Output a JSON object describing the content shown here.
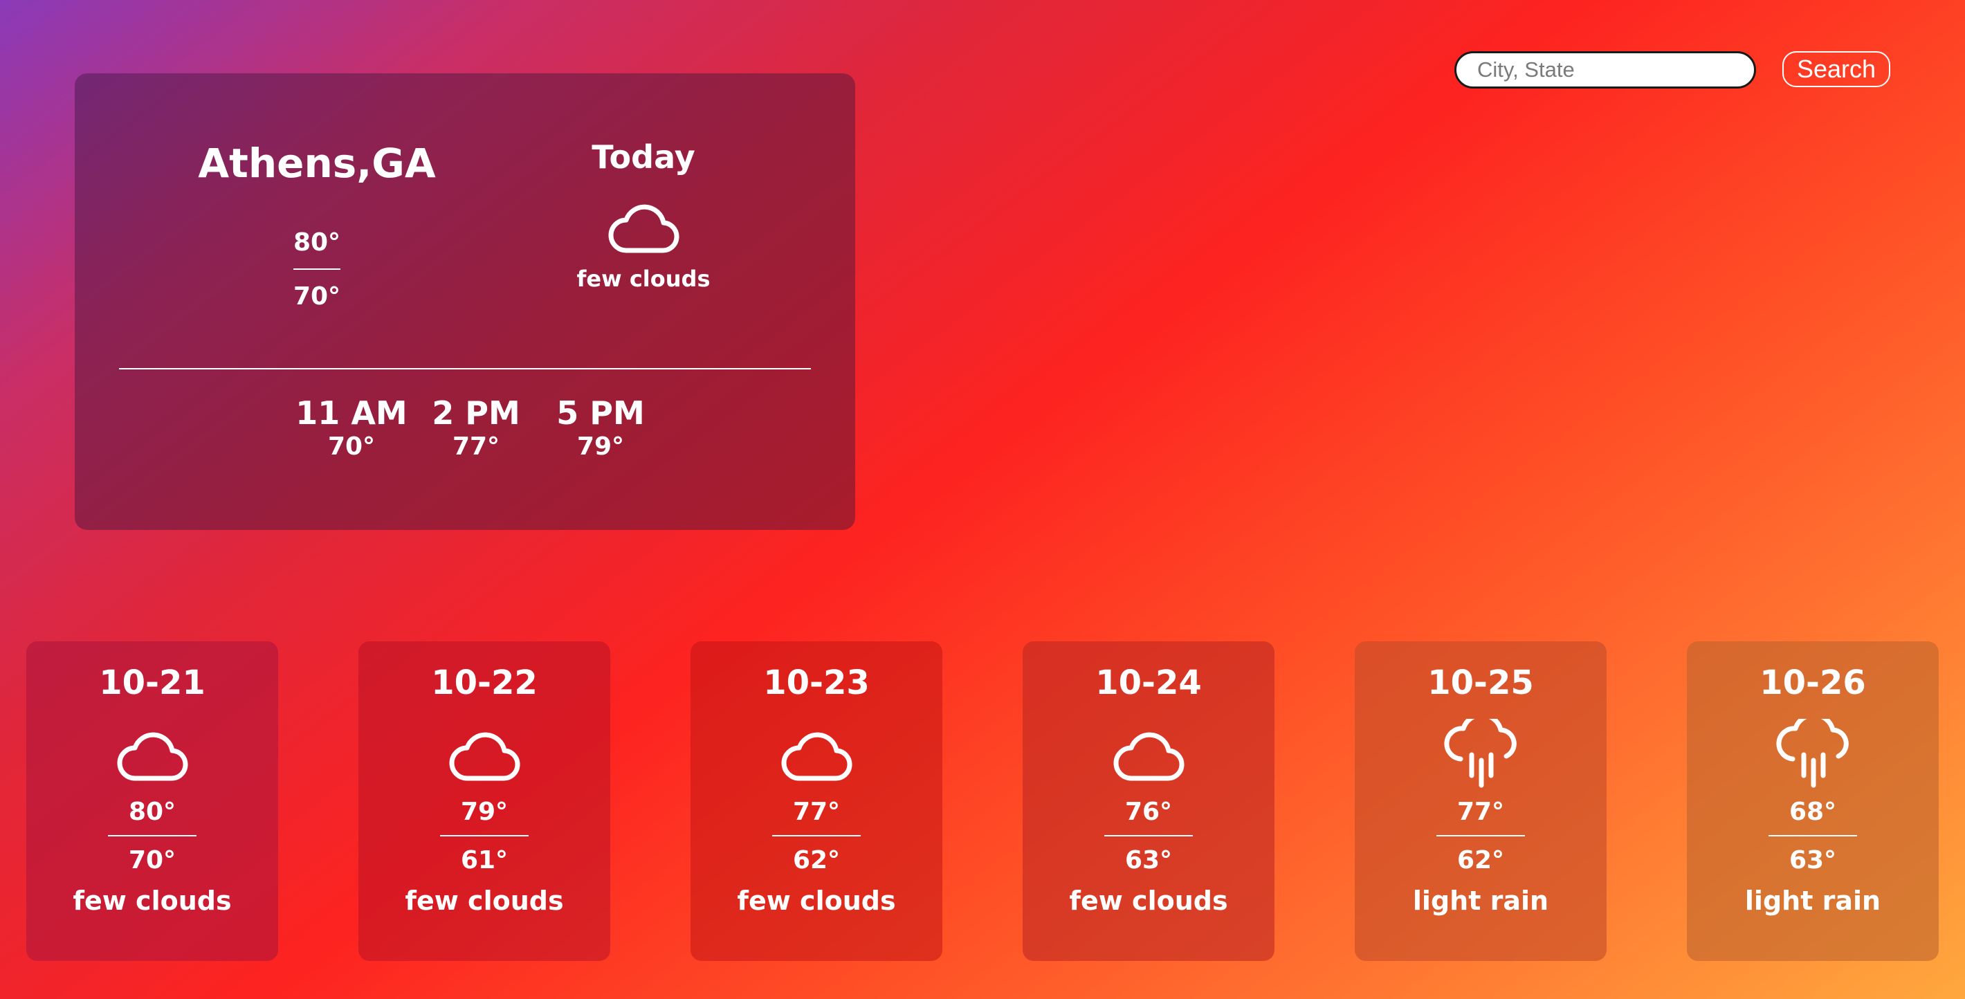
{
  "search": {
    "placeholder": "City, State",
    "button_label": "Search"
  },
  "current": {
    "city": "Athens,GA",
    "high": "80°",
    "low": "70°",
    "day_label": "Today",
    "icon": "cloud-icon",
    "description": "few clouds",
    "hourly": [
      {
        "time": "11 AM",
        "temp": "70°"
      },
      {
        "time": "2 PM",
        "temp": "77°"
      },
      {
        "time": "5 PM",
        "temp": "79°"
      }
    ]
  },
  "forecast": [
    {
      "date": "10-21",
      "icon": "cloud-icon",
      "high": "80°",
      "low": "70°",
      "description": "few clouds"
    },
    {
      "date": "10-22",
      "icon": "cloud-icon",
      "high": "79°",
      "low": "61°",
      "description": "few clouds"
    },
    {
      "date": "10-23",
      "icon": "cloud-icon",
      "high": "77°",
      "low": "62°",
      "description": "few clouds"
    },
    {
      "date": "10-24",
      "icon": "cloud-icon",
      "high": "76°",
      "low": "63°",
      "description": "few clouds"
    },
    {
      "date": "10-25",
      "icon": "rain-cloud-icon",
      "high": "77°",
      "low": "62°",
      "description": "light rain"
    },
    {
      "date": "10-26",
      "icon": "rain-cloud-icon",
      "high": "68°",
      "low": "63°",
      "description": "light rain"
    }
  ],
  "colors": {
    "background_start": "#8a3ab9",
    "background_mid": "#fd2320",
    "background_end": "#ffa83e",
    "text": "#ffffff"
  }
}
